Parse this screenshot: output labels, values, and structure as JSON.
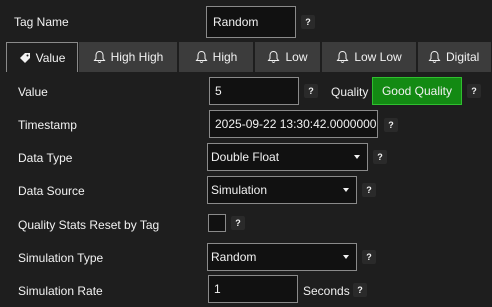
{
  "tag_name": {
    "label": "Tag Name",
    "value": "Random"
  },
  "tabs": [
    {
      "label": "Value",
      "icon": "tag-icon",
      "active": true
    },
    {
      "label": "High High",
      "icon": "bell-icon"
    },
    {
      "label": "High",
      "icon": "bell-icon"
    },
    {
      "label": "Low",
      "icon": "bell-icon"
    },
    {
      "label": "Low Low",
      "icon": "bell-icon"
    },
    {
      "label": "Digital",
      "icon": "bell-icon"
    }
  ],
  "fields": {
    "value": {
      "label": "Value",
      "value": "5"
    },
    "quality": {
      "label": "Quality",
      "value": "Good Quality",
      "color": "#138a13"
    },
    "timestamp": {
      "label": "Timestamp",
      "value": "2025-09-22 13:30:42.0000000"
    },
    "data_type": {
      "label": "Data Type",
      "value": "Double Float"
    },
    "data_source": {
      "label": "Data Source",
      "value": "Simulation"
    },
    "quality_stats_reset": {
      "label": "Quality Stats Reset by Tag",
      "checked": false
    },
    "simulation_type": {
      "label": "Simulation Type",
      "value": "Random"
    },
    "simulation_rate": {
      "label": "Simulation Rate",
      "value": "1",
      "unit": "Seconds"
    }
  },
  "help_glyph": "?",
  "colors": {
    "background": "#1e1e1e",
    "tab": "#3c3c3c",
    "good_quality": "#138a13"
  }
}
